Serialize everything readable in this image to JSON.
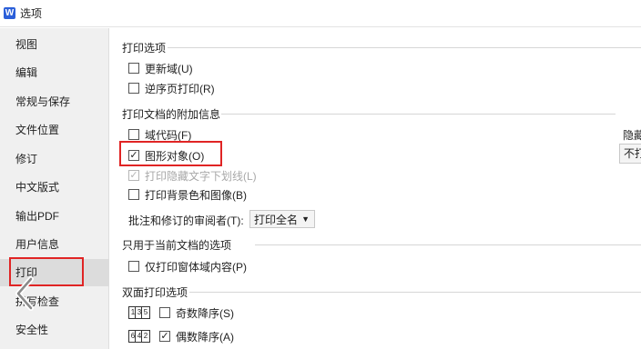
{
  "window": {
    "title": "选项",
    "app_icon": "W"
  },
  "sidebar": {
    "items": [
      {
        "label": "视图"
      },
      {
        "label": "编辑"
      },
      {
        "label": "常规与保存"
      },
      {
        "label": "文件位置"
      },
      {
        "label": "修订"
      },
      {
        "label": "中文版式"
      },
      {
        "label": "输出PDF"
      },
      {
        "label": "用户信息"
      },
      {
        "label": "打印",
        "selected": true
      },
      {
        "label": "拼写检查"
      },
      {
        "label": "安全性"
      }
    ]
  },
  "print_options": {
    "header": "打印选项",
    "update_fields": {
      "label": "更新域(U)",
      "checked": false
    },
    "reverse_order": {
      "label": "逆序页打印(R)",
      "checked": false
    }
  },
  "extra_info": {
    "header": "打印文档的附加信息",
    "field_codes": {
      "label": "域代码(F)",
      "checked": false
    },
    "drawing_objects": {
      "label": "图形对象(O)",
      "checked": true
    },
    "hidden_underline": {
      "label": "打印隐藏文字下划线(L)",
      "checked": true,
      "disabled": true
    },
    "background": {
      "label": "打印背景色和图像(B)",
      "checked": false
    },
    "reviewer_label": "批注和修订的审阅者(T):",
    "reviewer_value": "打印全名"
  },
  "current_doc": {
    "header": "只用于当前文档的选项",
    "form_data": {
      "label": "仅打印窗体域内容(P)",
      "checked": false
    }
  },
  "duplex": {
    "header": "双面打印选项",
    "odd_reverse": {
      "label": "奇数降序(S)",
      "checked": false,
      "pages": [
        "1",
        "3",
        "5"
      ]
    },
    "even_reverse": {
      "label": "偶数降序(A)",
      "checked": true,
      "pages": [
        "6",
        "4",
        "2"
      ]
    }
  },
  "right_panel": {
    "label": "隐藏",
    "value": "不打"
  },
  "colors": {
    "highlight": "#e02424",
    "sidebar_bg": "#f0f0f0",
    "selected_bg": "#dcdcdc"
  }
}
